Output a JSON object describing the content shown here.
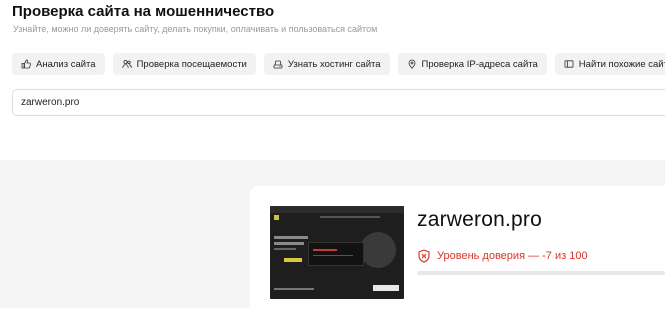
{
  "header": {
    "title": "Проверка сайта на мошенничество",
    "subtitle": "Узнайте, можно ли доверять сайту, делать покупки, оплачивать и пользоваться сайтом"
  },
  "chips": [
    {
      "label": "Анализ сайта",
      "icon": "thumbs-up-icon"
    },
    {
      "label": "Проверка посещаемости",
      "icon": "people-icon"
    },
    {
      "label": "Узнать хостинг сайта",
      "icon": "server-icon"
    },
    {
      "label": "Проверка IP-адреса сайта",
      "icon": "location-pin-icon"
    },
    {
      "label": "Найти похожие сайты",
      "icon": "window-icon"
    }
  ],
  "search": {
    "value": "zarweron.pro"
  },
  "result": {
    "domain": "zarweron.pro",
    "trust_label": "Уровень доверия — -7 из 100",
    "trust_score": -7,
    "trust_max": 100,
    "trust_color": "#d9362b",
    "trust_icon": "shield-warning-icon"
  }
}
